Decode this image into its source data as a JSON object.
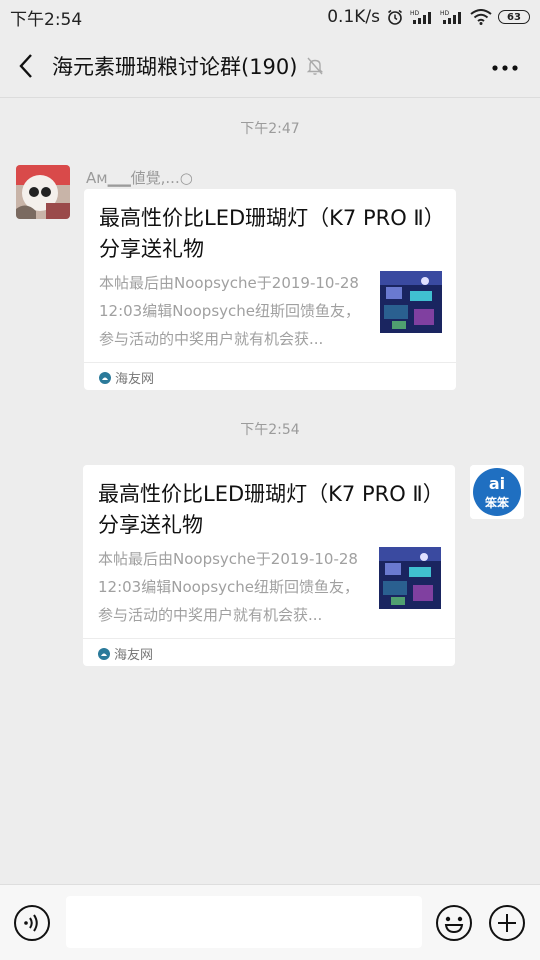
{
  "status_bar": {
    "time": "下午2:54",
    "speed": "0.1K/s",
    "battery": "63"
  },
  "header": {
    "title": "海元素珊瑚粮讨论群(190)"
  },
  "messages": [
    {
      "timestamp": "下午2:47",
      "sender": "Aм▁▁値覺,...○",
      "card": {
        "title": "最高性价比LED珊瑚灯（K7 PRO Ⅱ）分享送礼物",
        "description": "本帖最后由Noopsyche于2019-10-2812:03编辑Noopsyche纽斯回馈鱼友，参与活动的中奖用户就有机会获...",
        "source": "海友网"
      }
    },
    {
      "timestamp": "下午2:54",
      "card": {
        "title": "最高性价比LED珊瑚灯（K7 PRO Ⅱ）分享送礼物",
        "description": "本帖最后由Noopsyche于2019-10-2812:03编辑Noopsyche纽斯回馈鱼友，参与活动的中奖用户就有机会获...",
        "source": "海友网"
      }
    }
  ],
  "self_avatar": {
    "text_top": "ai",
    "text_bottom": "笨笨"
  },
  "input": {
    "value": "",
    "placeholder": ""
  },
  "colors": {
    "background": "#ededed",
    "card": "#ffffff",
    "timestamp": "#9b9b9b",
    "self_avatar": "#1f6fc1"
  }
}
